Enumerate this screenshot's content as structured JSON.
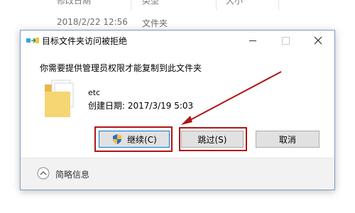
{
  "background_explorer": {
    "headers": [
      "修改日期",
      "类型",
      "大小"
    ],
    "row": {
      "date": "2018/2/22 12:56",
      "type": "文件夹"
    }
  },
  "dialog": {
    "title": "目标文件夹访问被拒绝",
    "message": "你需要提供管理员权限才能复制到此文件夹",
    "file": {
      "name": "etc",
      "created": "创建日期: 2017/3/19 5:03"
    },
    "buttons": {
      "continue": "继续(C)",
      "skip": "跳过(S)",
      "cancel": "取消"
    },
    "footer": {
      "details_label": "简略信息"
    }
  },
  "colors": {
    "highlight": "#b01515",
    "dialog_border": "#7c9cc4",
    "footer_bg": "#f2f2f2",
    "button_bg": "#e1e1e1",
    "folder": "#f3d06b"
  },
  "icons": {
    "title": "move-copy-icon",
    "folder": "folder-icon",
    "continue_button": "uac-shield-icon",
    "footer": "chevron-up-circle-icon"
  }
}
